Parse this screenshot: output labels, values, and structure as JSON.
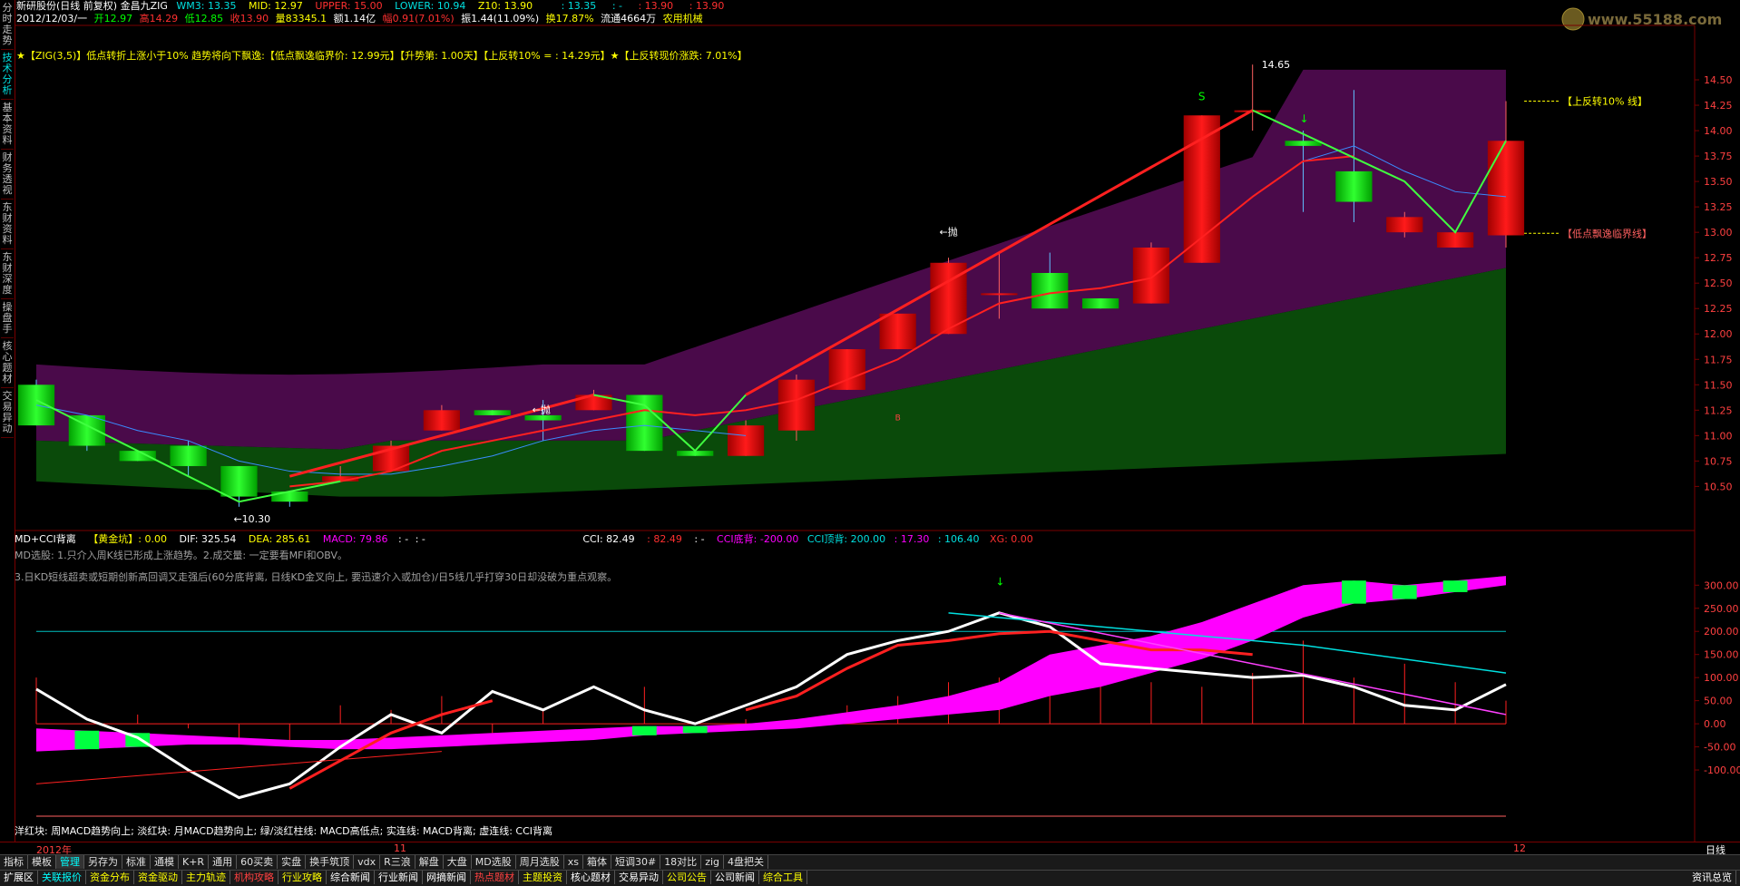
{
  "left_tabs": [
    "分时走势",
    "技术分析",
    "基本资料",
    "财务透视",
    "东财资料",
    "东财深度",
    "操盘手",
    "核心题材",
    "交易异动"
  ],
  "header": {
    "title": "新研股份(日线 前复权) 金昌九ZIG",
    "wm3": "WM3: 13.35",
    "mid": "MID: 12.97",
    "upper": "UPPER: 15.00",
    "lower": "LOWER: 10.94",
    "z10": "Z10: 13.90",
    "v1": ": 13.35",
    "v2": ": -",
    "v3": ": 13.90",
    "v4": ": 13.90",
    "date": "2012/12/03/一",
    "open": "开12.97",
    "high": "高14.29",
    "low": "低12.85",
    "close": "收13.90",
    "vol": "量83345.1",
    "amt": "额1.14亿",
    "chg": "幅0.91(7.01%)",
    "amp": "振1.44(11.09%)",
    "turnover": "换17.87%",
    "float": "流通4664万",
    "industry": "农用机械"
  },
  "annotation": "★【ZIG(3,5)】低点转折上涨小于10% 趋势将向下飘逸:【低点飘逸临界价: 12.99元】【升势第: 1.00天】【上反转10% = : 14.29元】★【上反转现价涨跌: 7.01%】",
  "logo_text": "www.55188.com",
  "price_axis": [
    "14.50",
    "14.25",
    "14.00",
    "13.75",
    "13.50",
    "13.25",
    "13.00",
    "12.75",
    "12.50",
    "12.25",
    "12.00",
    "11.75",
    "11.50",
    "11.25",
    "11.00",
    "10.75",
    "10.50"
  ],
  "price_labels": {
    "high_mark": "14.65",
    "low_mark": "10.30",
    "upper_line": "【上反转10% 线】",
    "lower_line": "【低点飘逸临界线】",
    "throw1": "←抛",
    "throw2": "←抛",
    "buy": "S",
    "b_mark": "B"
  },
  "sub_header": {
    "name": "MD+CCI背离",
    "gold": "【黄金坑】: 0.00",
    "dif": "DIF: 325.54",
    "dea": "DEA: 285.61",
    "macd": "MACD: 79.86",
    "dash": ": -",
    "dash2": ": -",
    "cci": "CCI: 82.49",
    "cci2": ": 82.49",
    "dash3": ": -",
    "cci_bottom": "CCI底背: -200.00",
    "cci_top": "CCI顶背: 200.00",
    "v17": ": 17.30",
    "v106": ": 106.40",
    "xg": "XG: 0.00"
  },
  "sub_line2": "MD选股: 1.只介入周K线已形成上涨趋势。2.成交量: 一定要看MFI和OBV。",
  "sub_line3": "3.日KD短线超卖或短期创新高回调又走强后(60分底背离, 日线KD金叉向上, 要迅速介入或加仓)/日5线几乎打穿30日却没破为重点观察。",
  "sub_axis": [
    "300.00",
    "250.00",
    "200.00",
    "150.00",
    "100.00",
    "50.00",
    "0.00",
    "-50.00",
    "-100.00"
  ],
  "legend": "洋红块: 周MACD趋势向上; 淡红块: 月MACD趋势向上; 绿/淡红柱线: MACD高低点; 实连线: MACD背离; 虚连线: CCI背离",
  "status_row": {
    "year": "2012年",
    "m11": "11",
    "m12": "12",
    "period": "日线"
  },
  "tabs1": [
    "指标",
    "模板",
    "管理",
    "另存为",
    "标准",
    "通模",
    "K+R",
    "通用",
    "60买卖",
    "实盘",
    "换手筑顶",
    "vdx",
    "R三浪",
    "解盘",
    "大盘",
    "MD选股",
    "周月选股",
    "xs",
    "箱体",
    "短调30#",
    "18对比",
    "zig",
    "4盘把关"
  ],
  "tabs2": [
    "扩展区",
    "关联报价",
    "资金分布",
    "资金驱动",
    "主力轨迹",
    "机构攻略",
    "行业攻略",
    "综合新闻",
    "行业新闻",
    "网摘新闻",
    "热点题材",
    "主题投资",
    "核心题材",
    "交易异动",
    "公司公告",
    "公司新闻",
    "综合工具"
  ],
  "bottom_right": "资讯总览",
  "colors": {
    "up": "#ff0000",
    "down": "#00ff00",
    "band_top": "#4a0a4a",
    "band_bottom": "#0a4a0a",
    "axis": "#7a0000",
    "magenta": "#ff00ff",
    "cyan": "#00e0e0"
  },
  "chart_data": {
    "type": "candlestick",
    "candles": [
      {
        "o": 11.5,
        "h": 11.55,
        "l": 11.1,
        "c": 11.1
      },
      {
        "o": 11.2,
        "h": 11.2,
        "l": 10.85,
        "c": 10.9
      },
      {
        "o": 10.85,
        "h": 10.85,
        "l": 10.75,
        "c": 10.75
      },
      {
        "o": 10.9,
        "h": 10.95,
        "l": 10.6,
        "c": 10.7
      },
      {
        "o": 10.7,
        "h": 10.7,
        "l": 10.3,
        "c": 10.4
      },
      {
        "o": 10.45,
        "h": 10.45,
        "l": 10.3,
        "c": 10.35
      },
      {
        "o": 10.55,
        "h": 10.7,
        "l": 10.55,
        "c": 10.6
      },
      {
        "o": 10.65,
        "h": 10.95,
        "l": 10.65,
        "c": 10.9
      },
      {
        "o": 11.05,
        "h": 11.3,
        "l": 11.05,
        "c": 11.25
      },
      {
        "o": 11.25,
        "h": 11.25,
        "l": 11.2,
        "c": 11.2
      },
      {
        "o": 11.2,
        "h": 11.35,
        "l": 10.95,
        "c": 11.15
      },
      {
        "o": 11.25,
        "h": 11.45,
        "l": 11.25,
        "c": 11.4
      },
      {
        "o": 11.4,
        "h": 11.4,
        "l": 10.85,
        "c": 10.85
      },
      {
        "o": 10.85,
        "h": 10.85,
        "l": 10.8,
        "c": 10.8
      },
      {
        "o": 10.8,
        "h": 11.15,
        "l": 10.8,
        "c": 11.1
      },
      {
        "o": 11.05,
        "h": 11.6,
        "l": 10.95,
        "c": 11.55
      },
      {
        "o": 11.45,
        "h": 11.85,
        "l": 11.45,
        "c": 11.85
      },
      {
        "o": 11.85,
        "h": 12.2,
        "l": 11.85,
        "c": 12.2
      },
      {
        "o": 12.0,
        "h": 12.75,
        "l": 12.0,
        "c": 12.7
      },
      {
        "o": 12.4,
        "h": 12.8,
        "l": 12.15,
        "c": 12.4
      },
      {
        "o": 12.6,
        "h": 12.8,
        "l": 12.35,
        "c": 12.25
      },
      {
        "o": 12.35,
        "h": 12.35,
        "l": 12.25,
        "c": 12.25
      },
      {
        "o": 12.3,
        "h": 12.9,
        "l": 12.3,
        "c": 12.85
      },
      {
        "o": 12.7,
        "h": 14.15,
        "l": 12.7,
        "c": 14.15
      },
      {
        "o": 14.2,
        "h": 14.65,
        "l": 14.0,
        "c": 14.2
      },
      {
        "o": 13.9,
        "h": 14.0,
        "l": 13.2,
        "c": 13.85
      },
      {
        "o": 13.6,
        "h": 14.4,
        "l": 13.1,
        "c": 13.3
      },
      {
        "o": 13.0,
        "h": 13.2,
        "l": 12.95,
        "c": 13.15
      },
      {
        "o": 12.85,
        "h": 13.0,
        "l": 12.85,
        "c": 13.0
      },
      {
        "o": 12.97,
        "h": 14.29,
        "l": 12.85,
        "c": 13.9
      }
    ],
    "zig": [
      11.35,
      null,
      null,
      null,
      10.3,
      null,
      null,
      null,
      null,
      null,
      null,
      11.4,
      null,
      10.8,
      null,
      null,
      null,
      null,
      null,
      null,
      null,
      null,
      null,
      null,
      14.2,
      null,
      null,
      null,
      12.99,
      13.9
    ],
    "ma_red": [
      null,
      null,
      null,
      null,
      null,
      10.5,
      10.55,
      10.65,
      10.85,
      10.95,
      11.05,
      11.15,
      11.25,
      11.2,
      11.25,
      11.35,
      11.55,
      11.75,
      12.05,
      12.3,
      12.4,
      12.45,
      12.55,
      12.95,
      13.35,
      13.7,
      13.75,
      null,
      null,
      null
    ],
    "ma_blue": [
      11.3,
      11.2,
      11.05,
      10.95,
      10.75,
      10.65,
      10.62,
      10.62,
      10.7,
      10.8,
      10.95,
      11.05,
      11.1,
      11.05,
      11.0,
      null,
      null,
      null,
      null,
      null,
      null,
      null,
      null,
      null,
      null,
      13.7,
      13.85,
      13.6,
      13.4,
      13.35
    ],
    "upper_line": 14.29,
    "lower_line": 12.99,
    "ylim": [
      10.2,
      14.75
    ]
  }
}
